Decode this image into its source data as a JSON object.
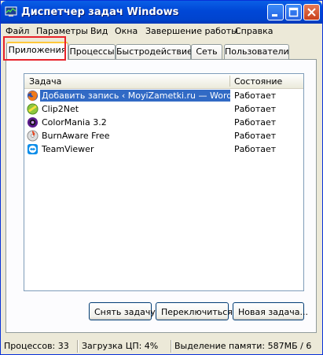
{
  "window": {
    "title": "Диспетчер задач Windows"
  },
  "menu": [
    "Файл",
    "Параметры",
    "Вид",
    "Окна",
    "Завершение работы",
    "Справка"
  ],
  "tabs": [
    "Приложения",
    "Процессы",
    "Быстродействие",
    "Сеть",
    "Пользователи"
  ],
  "active_tab": "Приложения",
  "list": {
    "headers": {
      "task": "Задача",
      "status": "Состояние"
    },
    "rows": [
      {
        "name": "Добавить запись ‹ MoyiZametki.ru — WordPre...",
        "status": "Работает",
        "icon": "firefox-icon",
        "selected": true
      },
      {
        "name": "Clip2Net",
        "status": "Работает",
        "icon": "clip2net-icon",
        "selected": false
      },
      {
        "name": "ColorMania 3.2",
        "status": "Работает",
        "icon": "colormania-icon",
        "selected": false
      },
      {
        "name": "BurnAware Free",
        "status": "Работает",
        "icon": "burnaware-icon",
        "selected": false
      },
      {
        "name": "TeamViewer",
        "status": "Работает",
        "icon": "teamviewer-icon",
        "selected": false
      }
    ]
  },
  "buttons": {
    "end_task": "Снять задачу",
    "switch_to": "Переключиться",
    "new_task": "Новая задача..."
  },
  "statusbar": {
    "processes": "Процессов: 33",
    "cpu": "Загрузка ЦП: 4%",
    "memory": "Выделение памяти: 587МБ / 6"
  },
  "colors": {
    "titlebar": "#0054E3",
    "selection": "#316AC5",
    "highlight": "#E8232B"
  }
}
